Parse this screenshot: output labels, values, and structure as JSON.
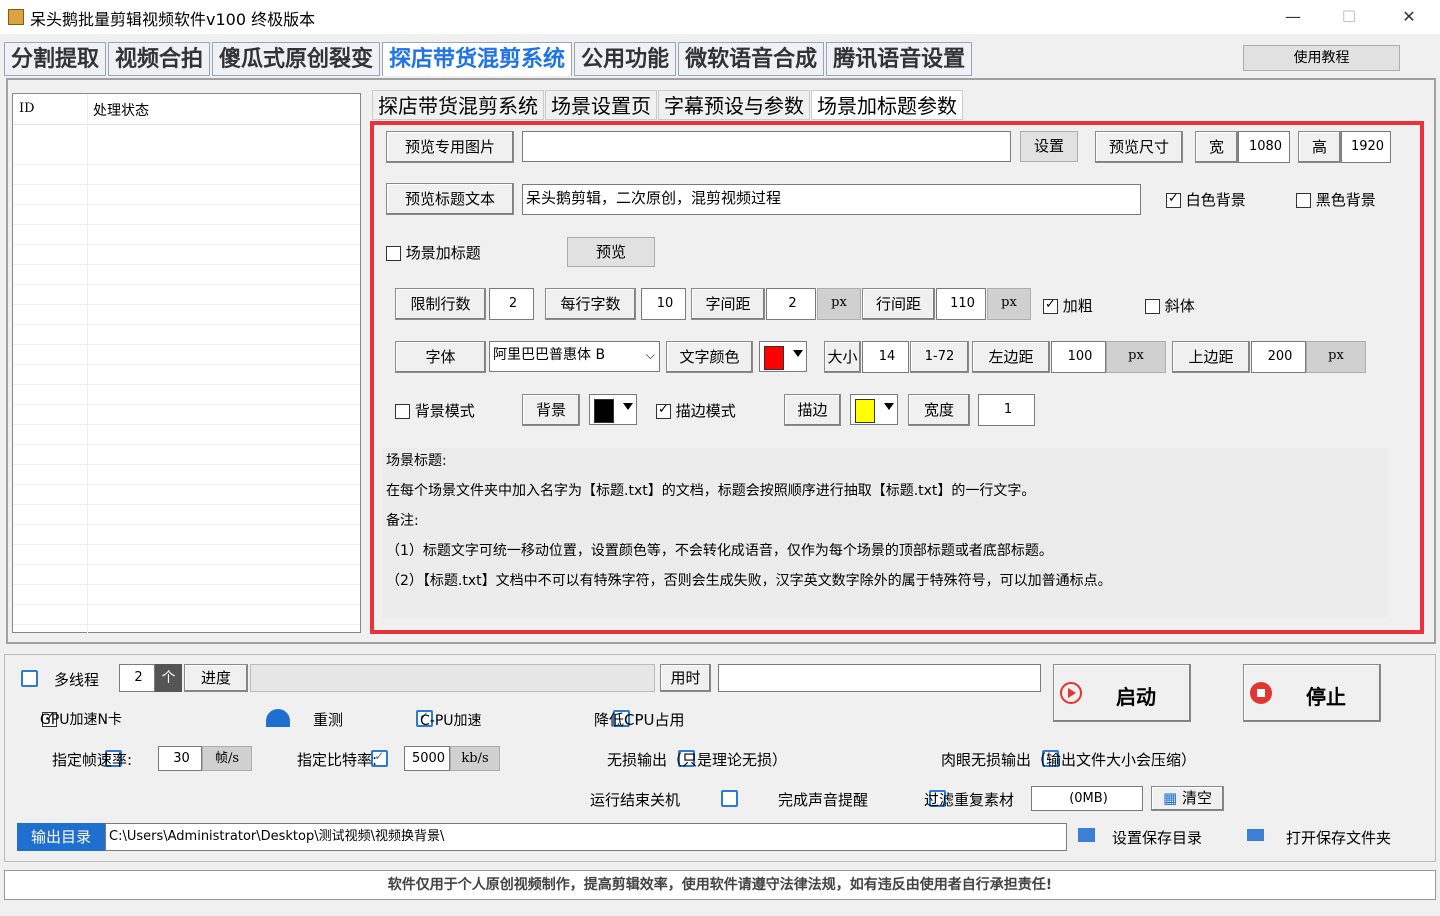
{
  "window": {
    "title": "呆头鹅批量剪辑视频软件v100 终极版本",
    "minimize": "—",
    "maximize": "☐",
    "close": "✕"
  },
  "main_tabs": [
    "分割提取",
    "视频合拍",
    "傻瓜式原创裂变",
    "探店带货混剪系统",
    "公用功能",
    "微软语音合成",
    "腾讯语音设置"
  ],
  "tutorial_button": "使用教程",
  "list": {
    "col_id": "ID",
    "col_status": "处理状态"
  },
  "sub_tabs": [
    "探店带货混剪系统",
    "场景设置页",
    "字幕预设与参数",
    "场景加标题参数"
  ],
  "preview": {
    "image_button": "预览专用图片",
    "image_path": "",
    "set_button": "设置",
    "size_button": "预览尺寸",
    "width_label": "宽",
    "width_value": "1080",
    "height_label": "高",
    "height_value": "1920"
  },
  "title_text": {
    "button": "预览标题文本",
    "value": "呆头鹅剪辑，二次原创，混剪视频过程",
    "white_bg": "白色背景",
    "black_bg": "黑色背景"
  },
  "scene_title": {
    "checkbox": "场景加标题",
    "preview_button": "预览"
  },
  "limits": {
    "max_lines_label": "限制行数",
    "max_lines": "2",
    "chars_per_line_label": "每行字数",
    "chars_per_line": "10",
    "char_spacing_label": "字间距",
    "char_spacing": "2",
    "px": "px",
    "line_spacing_label": "行间距",
    "line_spacing": "110",
    "bold": "加粗",
    "italic": "斜体"
  },
  "font": {
    "font_label": "字体",
    "font_value": "阿里巴巴普惠体 B",
    "text_color_label": "文字颜色",
    "text_color": "#ff0000",
    "size_label": "大小",
    "size_value": "14",
    "size_range": "1-72",
    "left_margin_label": "左边距",
    "left_margin": "100",
    "top_margin_label": "上边距",
    "top_margin": "200"
  },
  "bg": {
    "bg_mode": "背景模式",
    "bg_button": "背景",
    "bg_color": "#000000",
    "stroke_mode": "描边模式",
    "stroke_button": "描边",
    "stroke_color": "#ffff00",
    "width_label": "宽度",
    "width_value": "1"
  },
  "notes": {
    "l1": "场景标题:",
    "l2": "在每个场景文件夹中加入名字为【标题.txt】的文档，标题会按照顺序进行抽取【标题.txt】的一行文字。",
    "l3": "备注:",
    "l4": "（1）标题文字可统一移动位置，设置颜色等，不会转化成语音，仅作为每个场景的顶部标题或者底部标题。",
    "l5": "（2）【标题.txt】文档中不可以有特殊字符，否则会生成失败，汉字英文数字除外的属于特殊符号，可以加普通标点。"
  },
  "bottom": {
    "multithread": "多线程",
    "threads": "2",
    "unit_ge": "个",
    "progress_label": "进度",
    "time_label": "用时",
    "time_value": "",
    "start": "启动",
    "stop": "停止",
    "gpu_accel": "GPU加速N卡",
    "retest": "重测",
    "cpu_accel": "C-PU加速",
    "reduce_cpu": "降低CPU占用",
    "fps_label": "指定帧速率:",
    "fps": "30",
    "fps_unit": "帧/s",
    "bitrate_label": "指定比特率:",
    "bitrate": "5000",
    "bitrate_unit": "kb/s",
    "lossless": "无损输出（只是理论无损）",
    "visual_lossless": "肉眼无损输出（输出文件大小会压缩）",
    "shutdown": "运行结束关机",
    "sound": "完成声音提醒",
    "filter_dup": "过滤重复素材",
    "size_display": "(0MB)",
    "clear": "清空",
    "output_label": "输出目录",
    "output_path": "C:\\Users\\Administrator\\Desktop\\测试视频\\视频换背景\\",
    "set_save_dir": "设置保存目录",
    "open_save_dir": "打开保存文件夹"
  },
  "footer": "软件仅用于个人原创视频制作，提高剪辑效率，使用软件请遵守法律法规，如有违反由使用者自行承担责任!"
}
